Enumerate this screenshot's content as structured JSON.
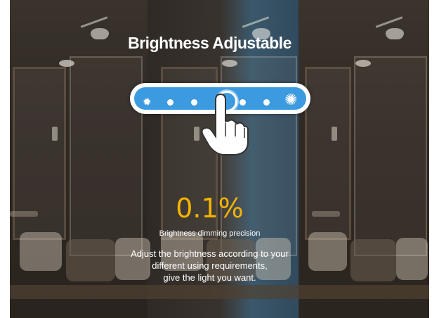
{
  "title": "Brightness Adjustable",
  "slider": {
    "min_icon": "sun-small-icon",
    "max_icon": "sun-large-icon",
    "step_count": 5,
    "selected_step": 3,
    "accent_color": "#3c9be0"
  },
  "precision": {
    "value": "0.1%",
    "label": "Brightness dimming precision",
    "color": "#f4b400"
  },
  "description": {
    "line1": "Adjust the brightness according to your",
    "line2": "different using requirements,",
    "line3": "give the light you want."
  }
}
